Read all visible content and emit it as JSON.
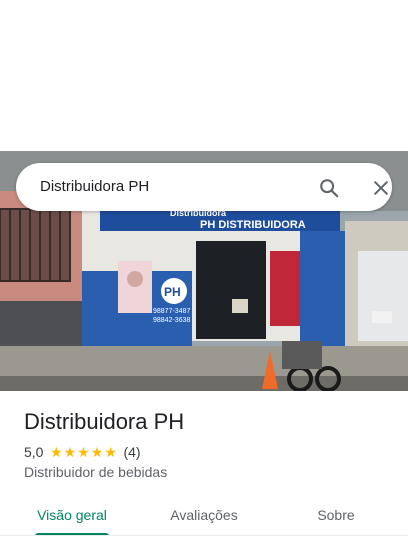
{
  "search": {
    "query": "Distribuidora PH",
    "search_icon": "search-icon",
    "close_icon": "close-icon"
  },
  "photo": {
    "description_icon": "storefront-photo",
    "sign_text": "Distribuidora",
    "sign_text_2": "PH DISTRIBUIDORA",
    "phone_1": "98877-3487",
    "phone_2": "98842-3638"
  },
  "place": {
    "title": "Distribuidora PH",
    "rating_value": "5,0",
    "stars": [
      "★",
      "★",
      "★",
      "★",
      "★"
    ],
    "review_count": "(4)",
    "category": "Distribuidor de bebidas"
  },
  "tabs": [
    {
      "label": "Visão geral",
      "active": true
    },
    {
      "label": "Avaliações",
      "active": false
    },
    {
      "label": "Sobre",
      "active": false
    }
  ],
  "colors": {
    "accent": "#01875f",
    "star": "#fbbc04"
  }
}
